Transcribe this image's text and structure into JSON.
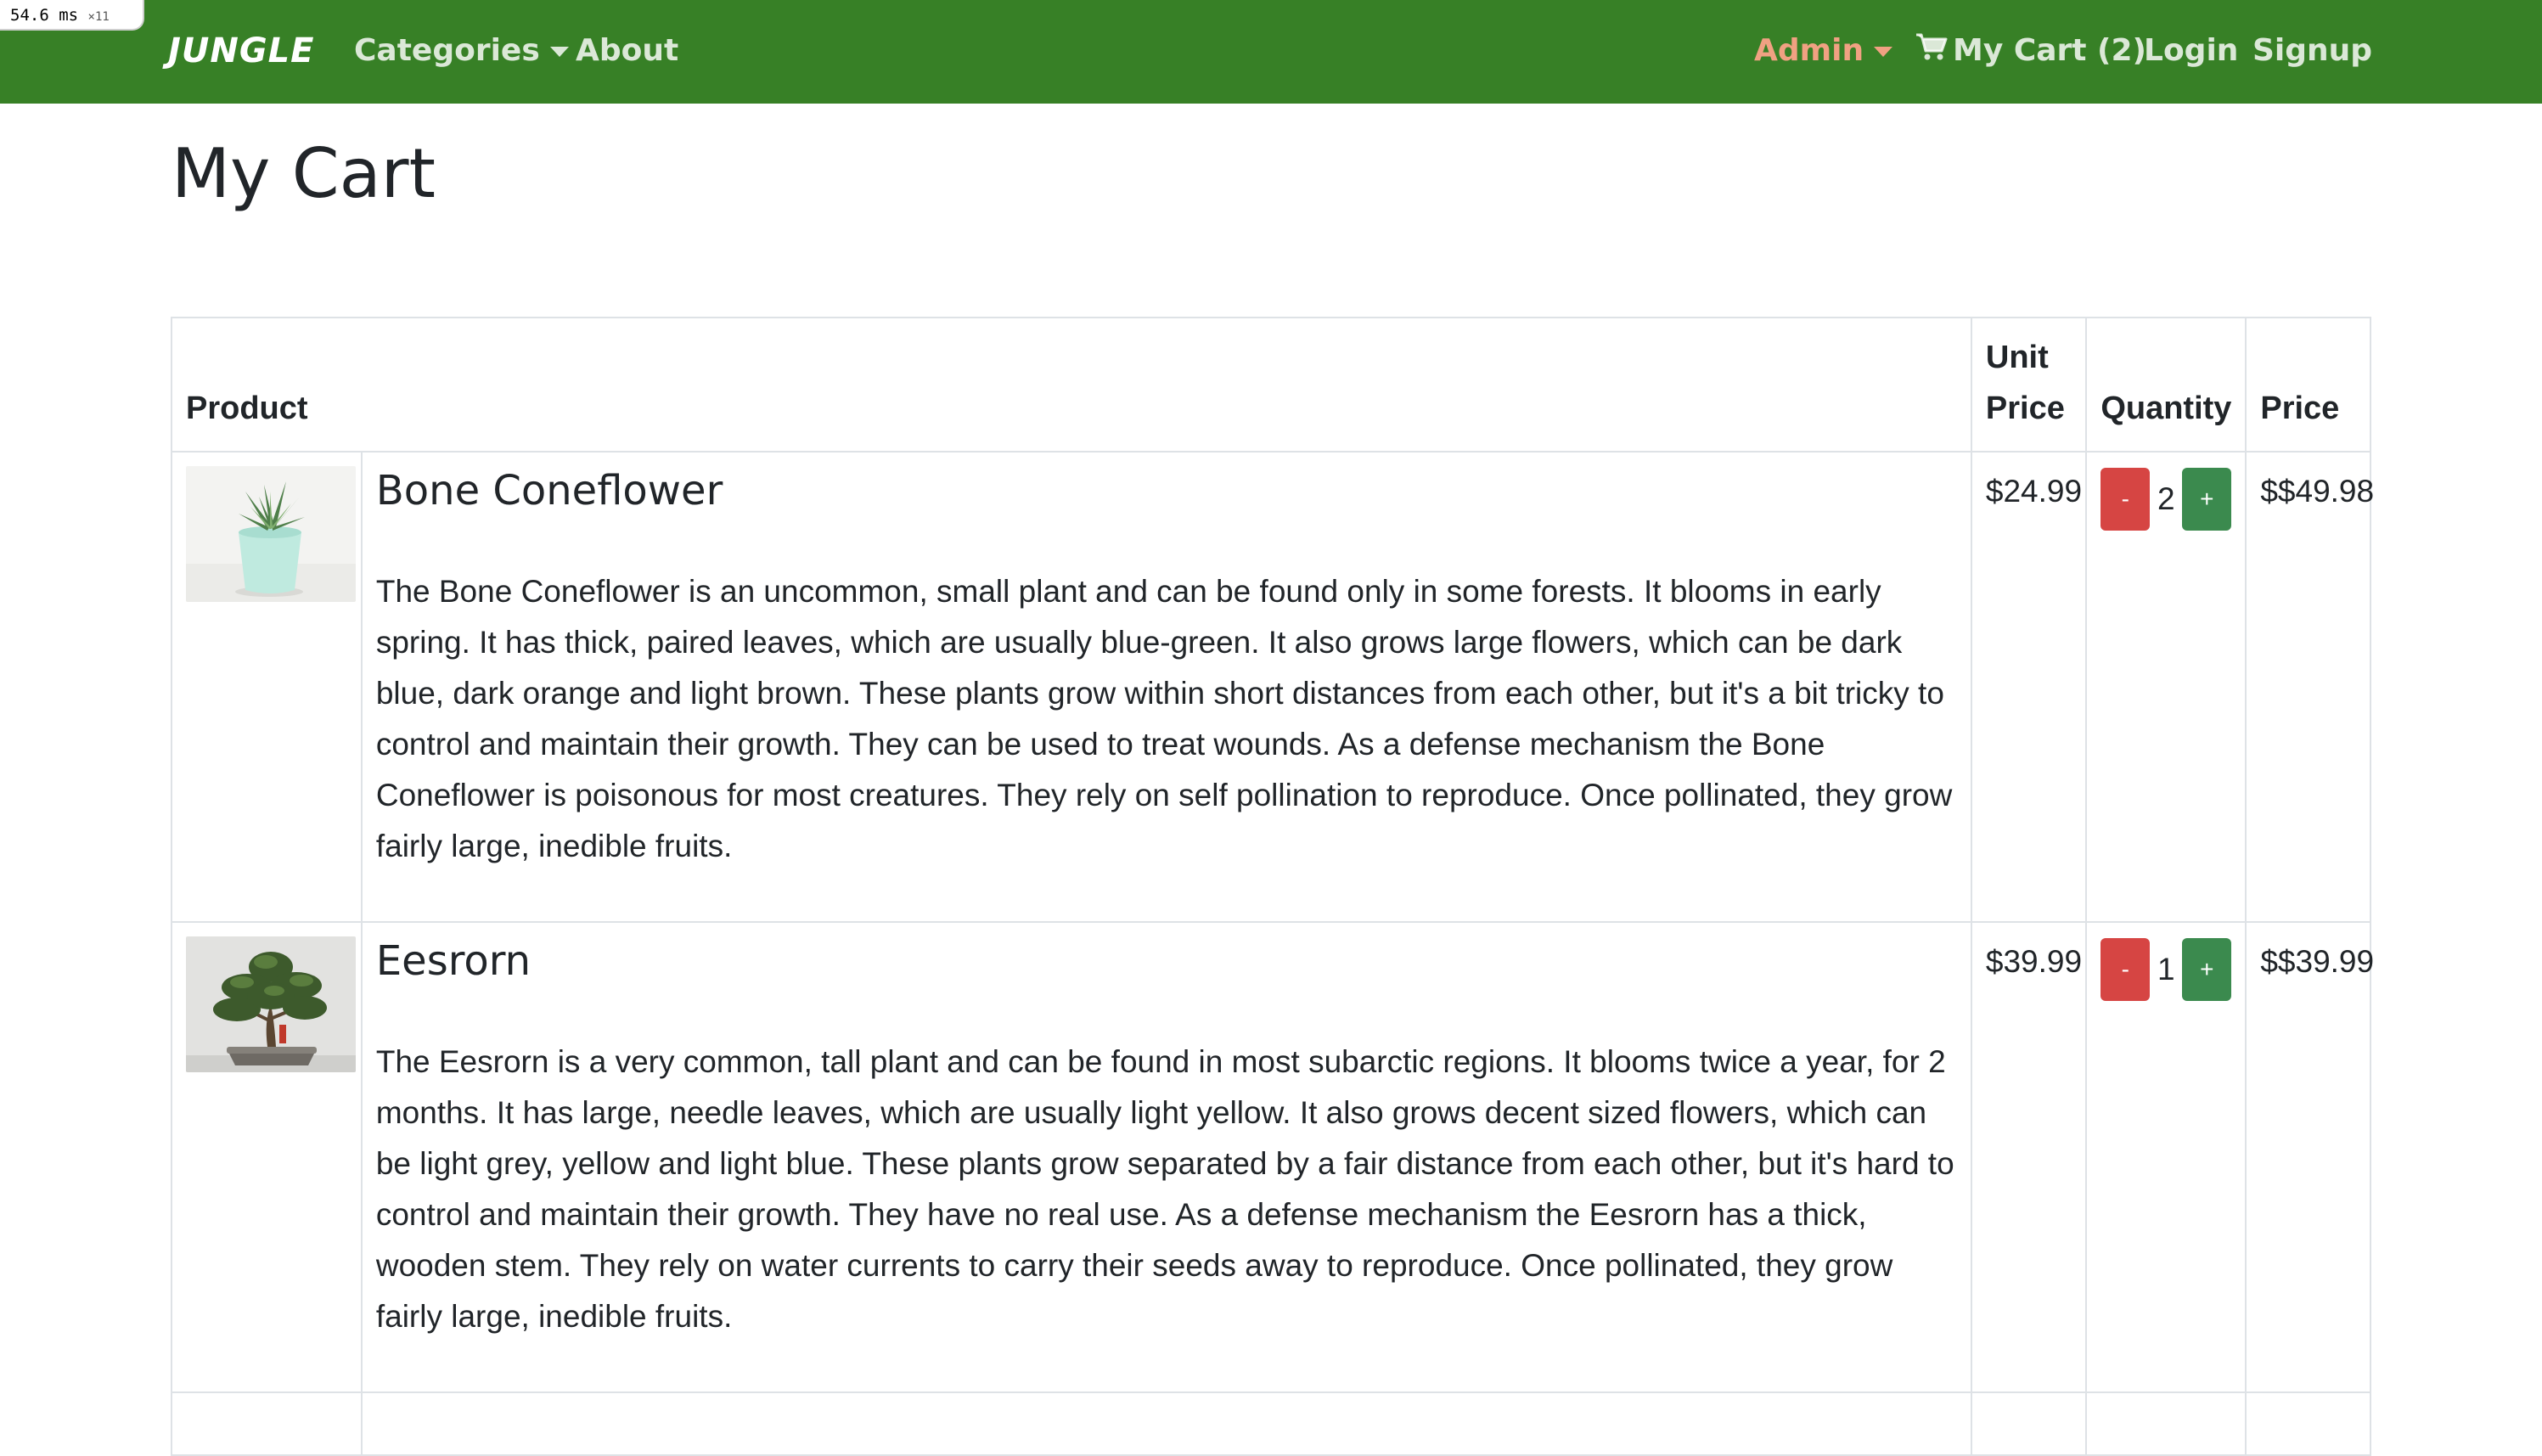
{
  "debug": {
    "time_label": "54.6 ms",
    "count_label": "×11"
  },
  "navbar": {
    "brand": "JUNGLE",
    "categories": "Categories",
    "about": "About",
    "admin": "Admin",
    "cart": "My Cart (2)",
    "login": "Login",
    "signup": "Signup",
    "bg_color": "#378026",
    "admin_color": "#f0a182"
  },
  "page": {
    "title": "My Cart"
  },
  "table": {
    "headers": {
      "product": "Product",
      "unit_price": "Unit Price",
      "quantity": "Quantity",
      "price": "Price"
    },
    "rows": [
      {
        "name": "Bone Coneflower",
        "description": "The Bone Coneflower is an uncommon, small plant and can be found only in some forests. It blooms in early spring. It has thick, paired leaves, which are usually blue-green. It also grows large flowers, which can be dark blue, dark orange and light brown. These plants grow within short distances from each other, but it's a bit tricky to control and maintain their growth. They can be used to treat wounds. As a defense mechanism the Bone Coneflower is poisonous for most creatures. They rely on self pollination to reproduce. Once pollinated, they grow fairly large, inedible fruits.",
        "unit_price": "$24.99",
        "quantity": "2",
        "price": "$$49.98",
        "image": "succulent-in-pot"
      },
      {
        "name": "Eesrorn",
        "description": "The Eesrorn is a very common, tall plant and can be found in most subarctic regions. It blooms twice a year, for 2 months. It has large, needle leaves, which are usually light yellow. It also grows decent sized flowers, which can be light grey, yellow and light blue. These plants grow separated by a fair distance from each other, but it's hard to control and maintain their growth. They have no real use. As a defense mechanism the Eesrorn has a thick, wooden stem. They rely on water currents to carry their seeds away to reproduce. Once pollinated, they grow fairly large, inedible fruits.",
        "unit_price": "$39.99",
        "quantity": "1",
        "price": "$$39.99",
        "image": "bonsai-tree"
      }
    ],
    "buttons": {
      "minus": "-",
      "plus": "+"
    },
    "minus_color": "#d64543",
    "plus_color": "#3b8a4e"
  }
}
